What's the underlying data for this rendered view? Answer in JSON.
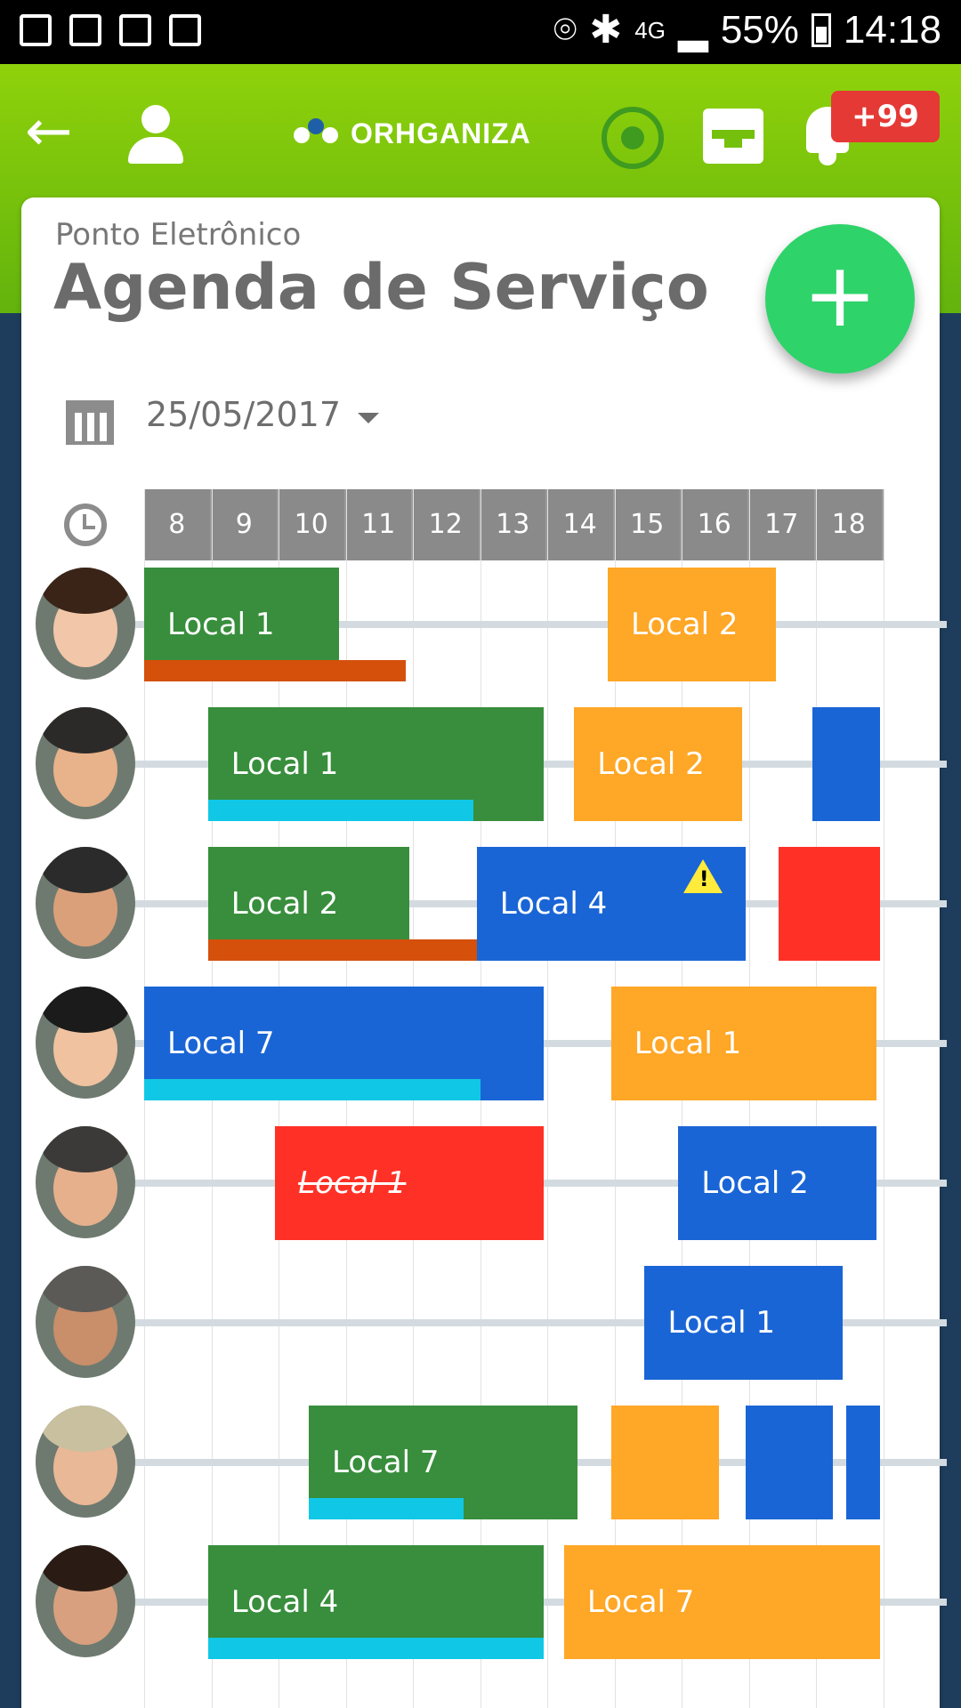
{
  "status_bar": {
    "network": "4G",
    "battery": "55%",
    "time": "14:18"
  },
  "app_bar": {
    "brand": "ORHGANIZA",
    "notifications_badge": "+99"
  },
  "page": {
    "subtitle": "Ponto Eletrônico",
    "title": "Agenda de Serviço",
    "date": "25/05/2017",
    "fab_label": "+"
  },
  "colors": {
    "app_bar": "#7cc70c",
    "fab": "#2ed36a",
    "in_progress": "#388e3c",
    "scheduled": "#ffa726",
    "other": "#1a65d6",
    "cancelled": "#ff3126"
  },
  "hours": [
    "8",
    "9",
    "10",
    "11",
    "12",
    "13",
    "14",
    "15",
    "16",
    "17",
    "18"
  ],
  "rows": [
    {
      "shifts": [
        {
          "label": "Local 1",
          "start": 8,
          "end": 10.9,
          "color": "green",
          "progress_end": 11.9,
          "progress_color": "rust"
        },
        {
          "label": "Local 2",
          "start": 14.9,
          "end": 17.4,
          "color": "orange"
        }
      ]
    },
    {
      "shifts": [
        {
          "label": "Local 1",
          "start": 8.95,
          "end": 13.95,
          "color": "green",
          "progress_end": 12.9,
          "progress_color": "cyan"
        },
        {
          "label": "Local 2",
          "start": 14.4,
          "end": 16.9,
          "color": "orange"
        },
        {
          "label": "",
          "start": 17.95,
          "end": 18.95,
          "color": "blue"
        }
      ]
    },
    {
      "shifts": [
        {
          "label": "Local 2",
          "start": 8.95,
          "end": 11.95,
          "color": "green",
          "progress_end": 13.95,
          "progress_color": "rust"
        },
        {
          "label": "Local 4",
          "start": 12.95,
          "end": 16.95,
          "color": "blue",
          "warning": true
        },
        {
          "label": "",
          "start": 17.45,
          "end": 18.95,
          "color": "red"
        }
      ]
    },
    {
      "shifts": [
        {
          "label": "Local 7",
          "start": 8,
          "end": 13.95,
          "color": "blue",
          "progress_end": 13,
          "progress_color": "cyan"
        },
        {
          "label": "Local 1",
          "start": 14.95,
          "end": 18.9,
          "color": "orange"
        }
      ]
    },
    {
      "shifts": [
        {
          "label": "Local 1",
          "start": 9.95,
          "end": 13.95,
          "color": "red",
          "cancelled": true
        },
        {
          "label": "Local 2",
          "start": 15.95,
          "end": 18.9,
          "color": "blue"
        }
      ]
    },
    {
      "shifts": [
        {
          "label": "Local 1",
          "start": 15.45,
          "end": 18.4,
          "color": "blue"
        }
      ]
    },
    {
      "shifts": [
        {
          "label": "Local 7",
          "start": 10.45,
          "end": 14.45,
          "color": "green",
          "progress_end": 12.75,
          "progress_color": "cyan"
        },
        {
          "label": "",
          "start": 14.95,
          "end": 16.55,
          "color": "orange"
        },
        {
          "label": "",
          "start": 16.95,
          "end": 18.25,
          "color": "blue"
        },
        {
          "label": "",
          "start": 18.45,
          "end": 18.95,
          "color": "blue"
        }
      ]
    },
    {
      "shifts": [
        {
          "label": "Local 4",
          "start": 8.95,
          "end": 13.95,
          "color": "green",
          "progress_end": 13.95,
          "progress_color": "cyan"
        },
        {
          "label": "Local 7",
          "start": 14.25,
          "end": 18.95,
          "color": "orange"
        }
      ]
    }
  ]
}
